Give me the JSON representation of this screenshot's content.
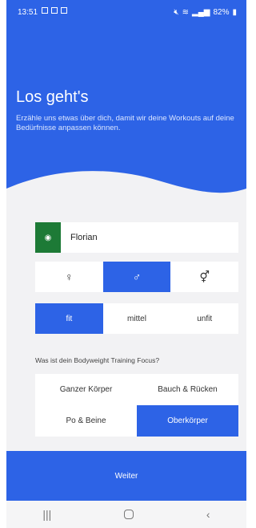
{
  "status": {
    "time": "13:51",
    "battery": "82%"
  },
  "hero": {
    "title": "Los geht's",
    "subtitle": "Erzähle uns etwas über dich, damit wir deine Workouts auf deine Bedürfnisse anpassen können."
  },
  "name_field": {
    "value": "Florian"
  },
  "gender": {
    "options": [
      "♀",
      "♂",
      "⚥"
    ],
    "selected_index": 1
  },
  "fitness": {
    "options": [
      "fit",
      "mittel",
      "unfit"
    ],
    "selected_index": 0
  },
  "focus": {
    "question": "Was ist dein Bodyweight Training Focus?",
    "options": [
      "Ganzer Körper",
      "Bauch & Rücken",
      "Po & Beine",
      "Oberkörper"
    ],
    "selected_index": 3
  },
  "next_button": {
    "label": "Weiter"
  },
  "colors": {
    "primary": "#2d63e6",
    "name_icon_bg": "#1d7a36"
  }
}
